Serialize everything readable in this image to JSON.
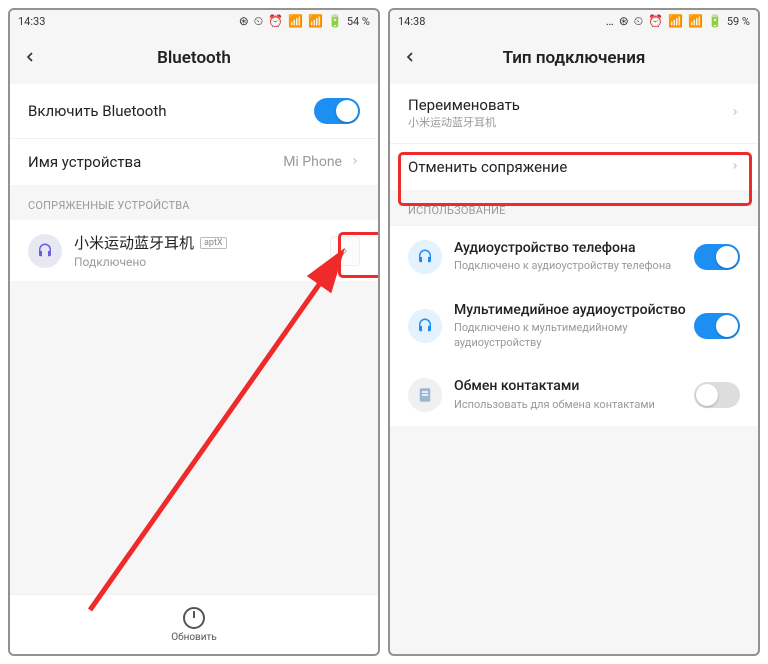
{
  "left": {
    "status": {
      "time": "14:33",
      "icons": "⊛ ⏲ ⏰ 📶 📶 🔋",
      "battery": "54 %"
    },
    "title": "Bluetooth",
    "enable_label": "Включить Bluetooth",
    "device_name_label": "Имя устройства",
    "device_name_value": "Mi Phone",
    "paired_header": "СОПРЯЖЕННЫЕ УСТРОЙСТВА",
    "device": {
      "name": "小米运动蓝牙耳机",
      "badge": "aptX",
      "status": "Подключено"
    },
    "refresh_label": "Обновить"
  },
  "right": {
    "status": {
      "time": "14:38",
      "icons": "… ⊛ ⏲ ⏰ 📶 📶 🔋",
      "battery": "59 %"
    },
    "title": "Тип подключения",
    "rename": {
      "label": "Переименовать",
      "sub": "小米运动蓝牙耳机"
    },
    "unpair_label": "Отменить сопряжение",
    "usage_header": "ИСПОЛЬЗОВАНИЕ",
    "usage": [
      {
        "title": "Аудиоустройство телефона",
        "sub": "Подключено к аудиоустройству телефона",
        "on": true
      },
      {
        "title": "Мультимедийное аудиоустройство",
        "sub": "Подключено к мультимедийному аудиоустройству",
        "on": true
      },
      {
        "title": "Обмен контактами",
        "sub": "Использовать для обмена контактами",
        "on": false
      }
    ]
  }
}
